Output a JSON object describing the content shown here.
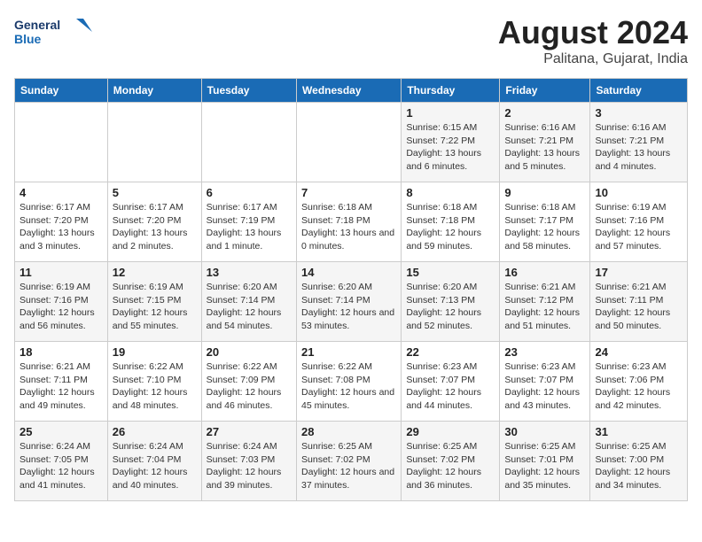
{
  "header": {
    "logo_line1": "General",
    "logo_line2": "Blue",
    "title": "August 2024",
    "subtitle": "Palitana, Gujarat, India"
  },
  "weekdays": [
    "Sunday",
    "Monday",
    "Tuesday",
    "Wednesday",
    "Thursday",
    "Friday",
    "Saturday"
  ],
  "weeks": [
    [
      {
        "day": "",
        "sunrise": "",
        "sunset": "",
        "daylight": ""
      },
      {
        "day": "",
        "sunrise": "",
        "sunset": "",
        "daylight": ""
      },
      {
        "day": "",
        "sunrise": "",
        "sunset": "",
        "daylight": ""
      },
      {
        "day": "",
        "sunrise": "",
        "sunset": "",
        "daylight": ""
      },
      {
        "day": "1",
        "sunrise": "Sunrise: 6:15 AM",
        "sunset": "Sunset: 7:22 PM",
        "daylight": "Daylight: 13 hours and 6 minutes."
      },
      {
        "day": "2",
        "sunrise": "Sunrise: 6:16 AM",
        "sunset": "Sunset: 7:21 PM",
        "daylight": "Daylight: 13 hours and 5 minutes."
      },
      {
        "day": "3",
        "sunrise": "Sunrise: 6:16 AM",
        "sunset": "Sunset: 7:21 PM",
        "daylight": "Daylight: 13 hours and 4 minutes."
      }
    ],
    [
      {
        "day": "4",
        "sunrise": "Sunrise: 6:17 AM",
        "sunset": "Sunset: 7:20 PM",
        "daylight": "Daylight: 13 hours and 3 minutes."
      },
      {
        "day": "5",
        "sunrise": "Sunrise: 6:17 AM",
        "sunset": "Sunset: 7:20 PM",
        "daylight": "Daylight: 13 hours and 2 minutes."
      },
      {
        "day": "6",
        "sunrise": "Sunrise: 6:17 AM",
        "sunset": "Sunset: 7:19 PM",
        "daylight": "Daylight: 13 hours and 1 minute."
      },
      {
        "day": "7",
        "sunrise": "Sunrise: 6:18 AM",
        "sunset": "Sunset: 7:18 PM",
        "daylight": "Daylight: 13 hours and 0 minutes."
      },
      {
        "day": "8",
        "sunrise": "Sunrise: 6:18 AM",
        "sunset": "Sunset: 7:18 PM",
        "daylight": "Daylight: 12 hours and 59 minutes."
      },
      {
        "day": "9",
        "sunrise": "Sunrise: 6:18 AM",
        "sunset": "Sunset: 7:17 PM",
        "daylight": "Daylight: 12 hours and 58 minutes."
      },
      {
        "day": "10",
        "sunrise": "Sunrise: 6:19 AM",
        "sunset": "Sunset: 7:16 PM",
        "daylight": "Daylight: 12 hours and 57 minutes."
      }
    ],
    [
      {
        "day": "11",
        "sunrise": "Sunrise: 6:19 AM",
        "sunset": "Sunset: 7:16 PM",
        "daylight": "Daylight: 12 hours and 56 minutes."
      },
      {
        "day": "12",
        "sunrise": "Sunrise: 6:19 AM",
        "sunset": "Sunset: 7:15 PM",
        "daylight": "Daylight: 12 hours and 55 minutes."
      },
      {
        "day": "13",
        "sunrise": "Sunrise: 6:20 AM",
        "sunset": "Sunset: 7:14 PM",
        "daylight": "Daylight: 12 hours and 54 minutes."
      },
      {
        "day": "14",
        "sunrise": "Sunrise: 6:20 AM",
        "sunset": "Sunset: 7:14 PM",
        "daylight": "Daylight: 12 hours and 53 minutes."
      },
      {
        "day": "15",
        "sunrise": "Sunrise: 6:20 AM",
        "sunset": "Sunset: 7:13 PM",
        "daylight": "Daylight: 12 hours and 52 minutes."
      },
      {
        "day": "16",
        "sunrise": "Sunrise: 6:21 AM",
        "sunset": "Sunset: 7:12 PM",
        "daylight": "Daylight: 12 hours and 51 minutes."
      },
      {
        "day": "17",
        "sunrise": "Sunrise: 6:21 AM",
        "sunset": "Sunset: 7:11 PM",
        "daylight": "Daylight: 12 hours and 50 minutes."
      }
    ],
    [
      {
        "day": "18",
        "sunrise": "Sunrise: 6:21 AM",
        "sunset": "Sunset: 7:11 PM",
        "daylight": "Daylight: 12 hours and 49 minutes."
      },
      {
        "day": "19",
        "sunrise": "Sunrise: 6:22 AM",
        "sunset": "Sunset: 7:10 PM",
        "daylight": "Daylight: 12 hours and 48 minutes."
      },
      {
        "day": "20",
        "sunrise": "Sunrise: 6:22 AM",
        "sunset": "Sunset: 7:09 PM",
        "daylight": "Daylight: 12 hours and 46 minutes."
      },
      {
        "day": "21",
        "sunrise": "Sunrise: 6:22 AM",
        "sunset": "Sunset: 7:08 PM",
        "daylight": "Daylight: 12 hours and 45 minutes."
      },
      {
        "day": "22",
        "sunrise": "Sunrise: 6:23 AM",
        "sunset": "Sunset: 7:07 PM",
        "daylight": "Daylight: 12 hours and 44 minutes."
      },
      {
        "day": "23",
        "sunrise": "Sunrise: 6:23 AM",
        "sunset": "Sunset: 7:07 PM",
        "daylight": "Daylight: 12 hours and 43 minutes."
      },
      {
        "day": "24",
        "sunrise": "Sunrise: 6:23 AM",
        "sunset": "Sunset: 7:06 PM",
        "daylight": "Daylight: 12 hours and 42 minutes."
      }
    ],
    [
      {
        "day": "25",
        "sunrise": "Sunrise: 6:24 AM",
        "sunset": "Sunset: 7:05 PM",
        "daylight": "Daylight: 12 hours and 41 minutes."
      },
      {
        "day": "26",
        "sunrise": "Sunrise: 6:24 AM",
        "sunset": "Sunset: 7:04 PM",
        "daylight": "Daylight: 12 hours and 40 minutes."
      },
      {
        "day": "27",
        "sunrise": "Sunrise: 6:24 AM",
        "sunset": "Sunset: 7:03 PM",
        "daylight": "Daylight: 12 hours and 39 minutes."
      },
      {
        "day": "28",
        "sunrise": "Sunrise: 6:25 AM",
        "sunset": "Sunset: 7:02 PM",
        "daylight": "Daylight: 12 hours and 37 minutes."
      },
      {
        "day": "29",
        "sunrise": "Sunrise: 6:25 AM",
        "sunset": "Sunset: 7:02 PM",
        "daylight": "Daylight: 12 hours and 36 minutes."
      },
      {
        "day": "30",
        "sunrise": "Sunrise: 6:25 AM",
        "sunset": "Sunset: 7:01 PM",
        "daylight": "Daylight: 12 hours and 35 minutes."
      },
      {
        "day": "31",
        "sunrise": "Sunrise: 6:25 AM",
        "sunset": "Sunset: 7:00 PM",
        "daylight": "Daylight: 12 hours and 34 minutes."
      }
    ]
  ]
}
